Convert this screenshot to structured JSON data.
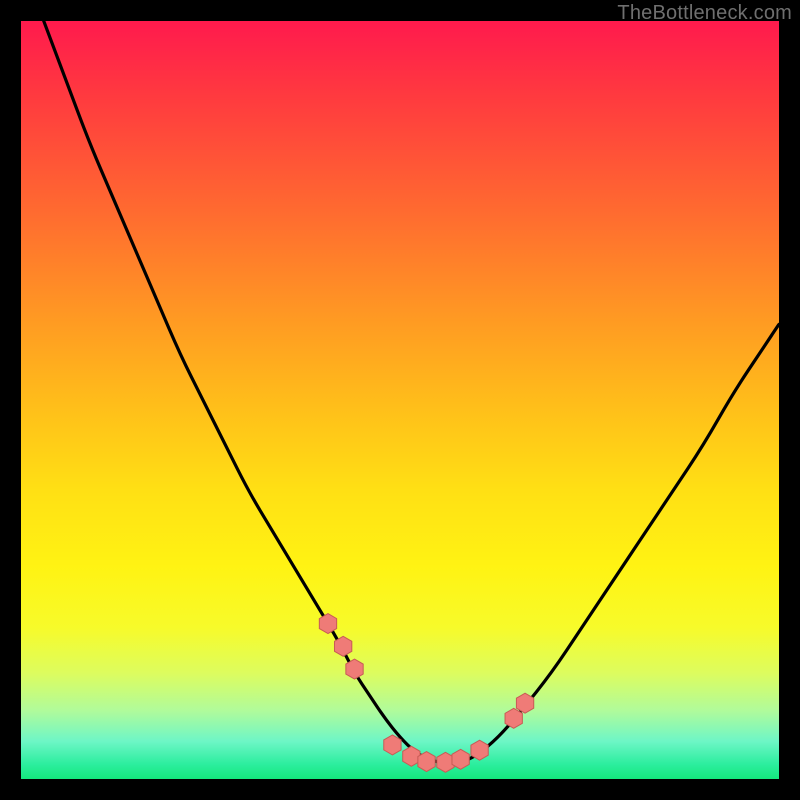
{
  "watermark": "TheBottleneck.com",
  "colors": {
    "curve": "#000000",
    "marker_fill": "#ef7b77",
    "marker_stroke": "#c85b55",
    "frame": "#000000"
  },
  "chart_data": {
    "type": "line",
    "title": "",
    "xlabel": "",
    "ylabel": "",
    "xlim": [
      0,
      100
    ],
    "ylim": [
      0,
      100
    ],
    "grid": false,
    "series": [
      {
        "name": "bottleneck-curve",
        "x": [
          3,
          6,
          9,
          12,
          15,
          18,
          21,
          24,
          27,
          30,
          33,
          36,
          39,
          42,
          44,
          46,
          48,
          50,
          52,
          54,
          56,
          58,
          60,
          63,
          66,
          70,
          74,
          78,
          82,
          86,
          90,
          94,
          98,
          100
        ],
        "values": [
          100,
          92,
          84,
          77,
          70,
          63,
          56,
          50,
          44,
          38,
          33,
          28,
          23,
          18,
          14,
          11,
          8,
          5.5,
          3.5,
          2.5,
          2,
          2.2,
          3,
          5.5,
          9,
          14,
          20,
          26,
          32,
          38,
          44,
          51,
          57,
          60
        ]
      }
    ],
    "markers": [
      {
        "x": 40.5,
        "y": 20.5
      },
      {
        "x": 42.5,
        "y": 17.5
      },
      {
        "x": 44.0,
        "y": 14.5
      },
      {
        "x": 49.0,
        "y": 4.5
      },
      {
        "x": 51.5,
        "y": 3.0
      },
      {
        "x": 53.5,
        "y": 2.3
      },
      {
        "x": 56.0,
        "y": 2.2
      },
      {
        "x": 58.0,
        "y": 2.6
      },
      {
        "x": 60.5,
        "y": 3.8
      },
      {
        "x": 65.0,
        "y": 8.0
      },
      {
        "x": 66.5,
        "y": 10.0
      }
    ],
    "marker_shape": "hexagon",
    "marker_size": 10
  }
}
